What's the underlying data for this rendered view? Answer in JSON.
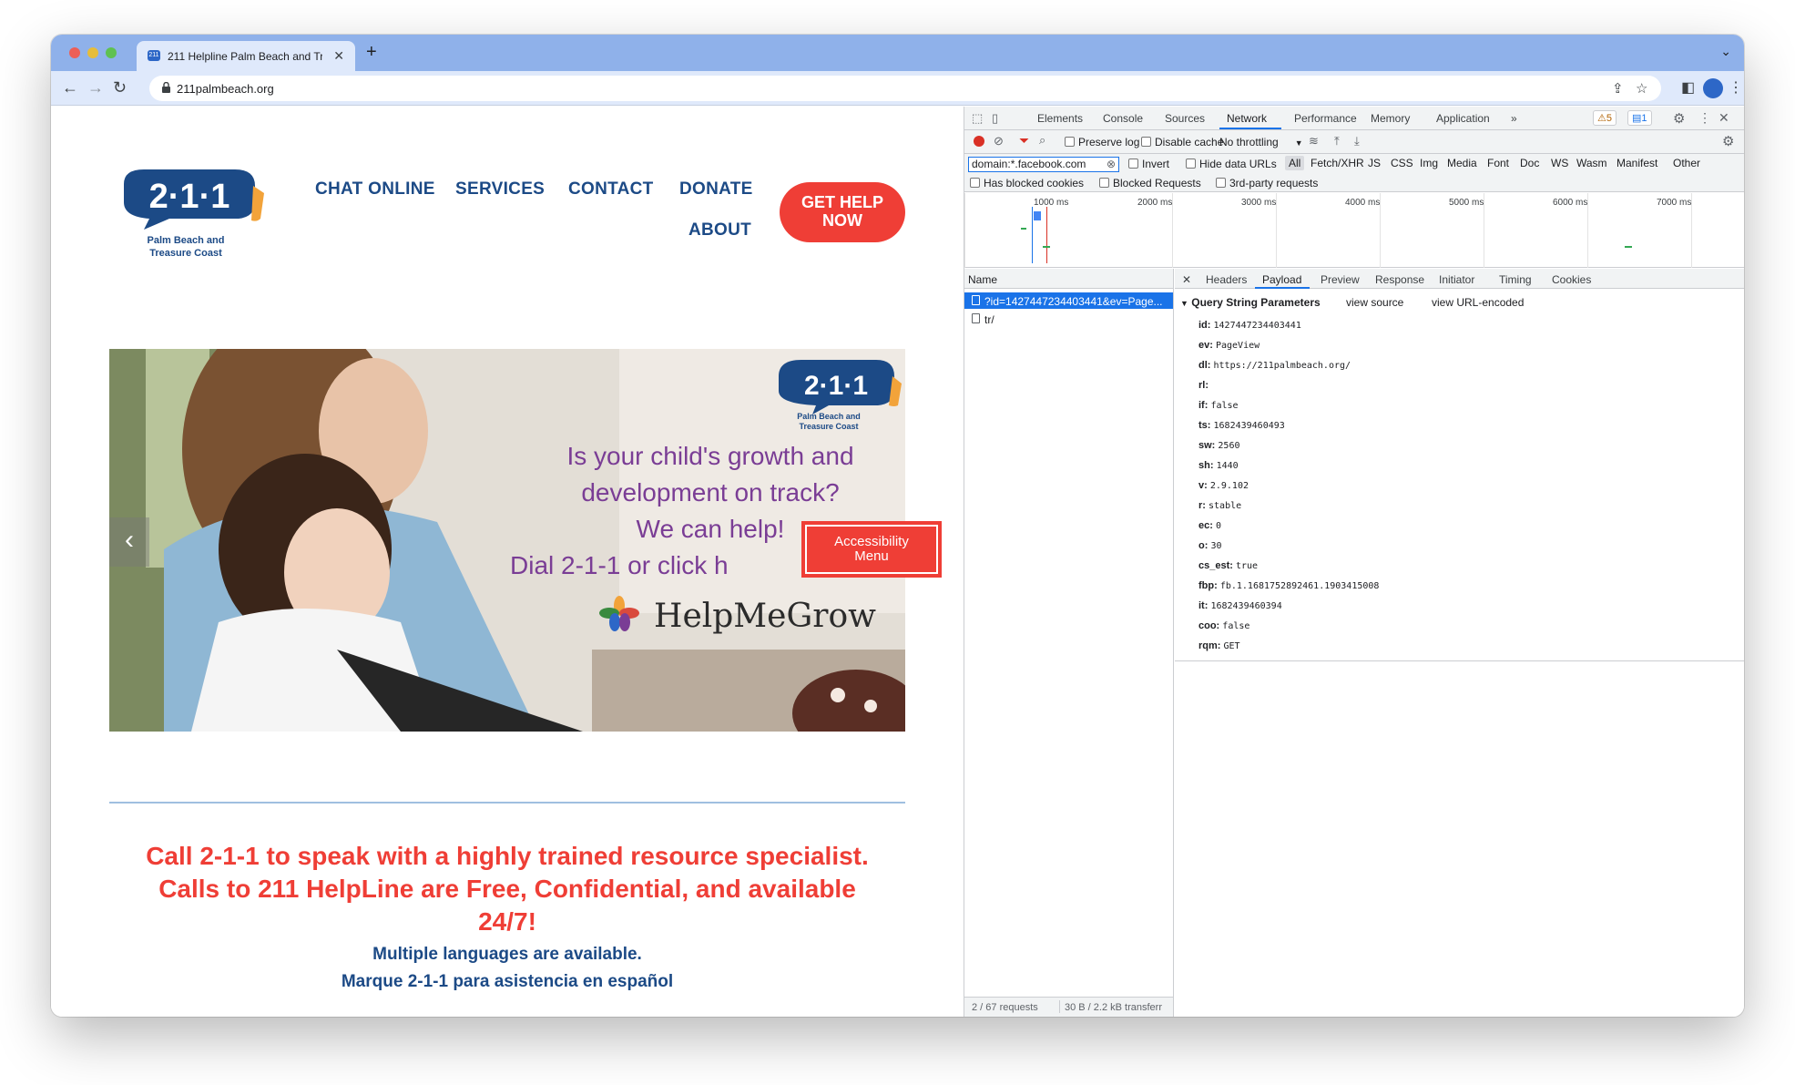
{
  "browser": {
    "tab_title": "211 Helpline Palm Beach and Tr",
    "tab_close": "✕",
    "new_tab": "+",
    "tab_menu": "⌄",
    "url": "211palmbeach.org",
    "colors": {
      "tabbar": "#8fb1ea",
      "toolbar": "#dfe9fb"
    }
  },
  "site": {
    "logo": {
      "number": "2·1·1",
      "line1": "Palm Beach and",
      "line2": "Treasure Coast"
    },
    "nav": {
      "chat_online": "CHAT ONLINE",
      "services": "SERVICES",
      "contact": "CONTACT",
      "donate": "DONATE",
      "about": "ABOUT"
    },
    "get_help": {
      "line1": "GET HELP",
      "line2": "NOW"
    },
    "hero": {
      "logo_line1": "Palm Beach and",
      "logo_line2": "Treasure Coast",
      "line1": "Is your child's growth and",
      "line2": "development on track?",
      "line3": "We can help!",
      "line4": "Dial 2-1-1 or click h",
      "brand": "HelpMeGrow",
      "prev_arrow": "‹"
    },
    "accessibility_menu": {
      "line1": "Accessibility",
      "line2": "Menu"
    },
    "callout": {
      "line1": "Call 2-1-1 to speak with a highly trained resource specialist.",
      "line2": "Calls to 211 HelpLine are Free, Confidential, and available",
      "line3": "24/7!"
    },
    "languages": "Multiple languages are available.",
    "spanish": "Marque 2-1-1 para asistencia en español",
    "colors": {
      "brand_blue": "#1c4a86",
      "accent_red": "#ef3e36",
      "purple": "#7a3d95"
    }
  },
  "devtools": {
    "tabs": [
      "Elements",
      "Console",
      "Sources",
      "Network",
      "Performance",
      "Memory",
      "Application"
    ],
    "active_tab": "Network",
    "more": "»",
    "warnings": "5",
    "messages": "1",
    "preserve_log": "Preserve log",
    "disable_cache": "Disable cache",
    "throttling": "No throttling",
    "filter_value": "domain:*.facebook.com",
    "invert": "Invert",
    "hide_data_urls": "Hide data URLs",
    "type_filters": [
      "All",
      "Fetch/XHR",
      "JS",
      "CSS",
      "Img",
      "Media",
      "Font",
      "Doc",
      "WS",
      "Wasm",
      "Manifest",
      "Other"
    ],
    "has_blocked_cookies": "Has blocked cookies",
    "blocked_requests": "Blocked Requests",
    "third_party": "3rd-party requests",
    "timeline_ticks": [
      "1000 ms",
      "2000 ms",
      "3000 ms",
      "4000 ms",
      "5000 ms",
      "6000 ms",
      "7000 ms"
    ],
    "name_header": "Name",
    "requests": [
      "?id=1427447234403441&ev=Page...",
      "tr/"
    ],
    "status_requests": "2 / 67 requests",
    "status_transfer": "30 B / 2.2 kB transferr",
    "detail_close": "✕",
    "detail_tabs": [
      "Headers",
      "Payload",
      "Preview",
      "Response",
      "Initiator",
      "Timing",
      "Cookies"
    ],
    "active_detail_tab": "Payload",
    "qsp_title": "Query String Parameters",
    "view_source": "view source",
    "view_url_encoded": "view URL-encoded",
    "params": [
      {
        "k": "id:",
        "v": "1427447234403441"
      },
      {
        "k": "ev:",
        "v": "PageView"
      },
      {
        "k": "dl:",
        "v": "https://211palmbeach.org/"
      },
      {
        "k": "rl:",
        "v": ""
      },
      {
        "k": "if:",
        "v": "false"
      },
      {
        "k": "ts:",
        "v": "1682439460493"
      },
      {
        "k": "sw:",
        "v": "2560"
      },
      {
        "k": "sh:",
        "v": "1440"
      },
      {
        "k": "v:",
        "v": "2.9.102"
      },
      {
        "k": "r:",
        "v": "stable"
      },
      {
        "k": "ec:",
        "v": "0"
      },
      {
        "k": "o:",
        "v": "30"
      },
      {
        "k": "cs_est:",
        "v": "true"
      },
      {
        "k": "fbp:",
        "v": "fb.1.1681752892461.1903415008"
      },
      {
        "k": "it:",
        "v": "1682439460394"
      },
      {
        "k": "coo:",
        "v": "false"
      },
      {
        "k": "rqm:",
        "v": "GET"
      }
    ]
  }
}
